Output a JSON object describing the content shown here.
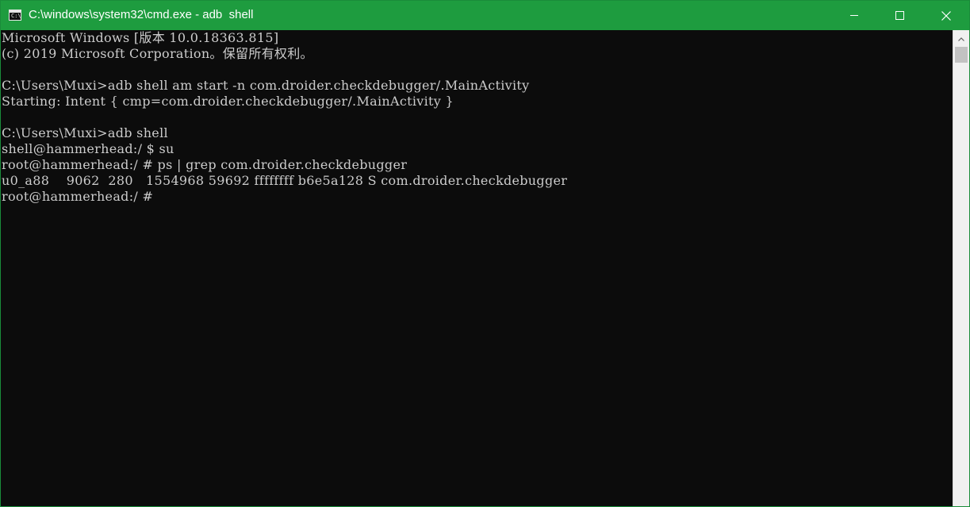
{
  "window": {
    "title": "C:\\windows\\system32\\cmd.exe - adb  shell"
  },
  "titlebar": {
    "icon": "cmd-icon",
    "icon_text": "C:\\",
    "buttons": [
      "minimize-icon",
      "maximize-icon",
      "close-icon"
    ]
  },
  "console": {
    "lines": [
      "Microsoft Windows [版本 10.0.18363.815]",
      "(c) 2019 Microsoft Corporation。保留所有权利。",
      "",
      "C:\\Users\\Muxi>adb shell am start -n com.droider.checkdebugger/.MainActivity",
      "Starting: Intent { cmp=com.droider.checkdebugger/.MainActivity }",
      "",
      "C:\\Users\\Muxi>adb shell",
      "shell@hammerhead:/ $ su",
      "root@hammerhead:/ # ps | grep com.droider.checkdebugger",
      "u0_a88    9062  280   1554968 59692 ffffffff b6e5a128 S com.droider.checkdebugger",
      "root@hammerhead:/ #"
    ]
  },
  "colors": {
    "titlebar": "#1e9c3f",
    "console_bg": "#0c0c0c",
    "console_text": "#cccccc"
  }
}
